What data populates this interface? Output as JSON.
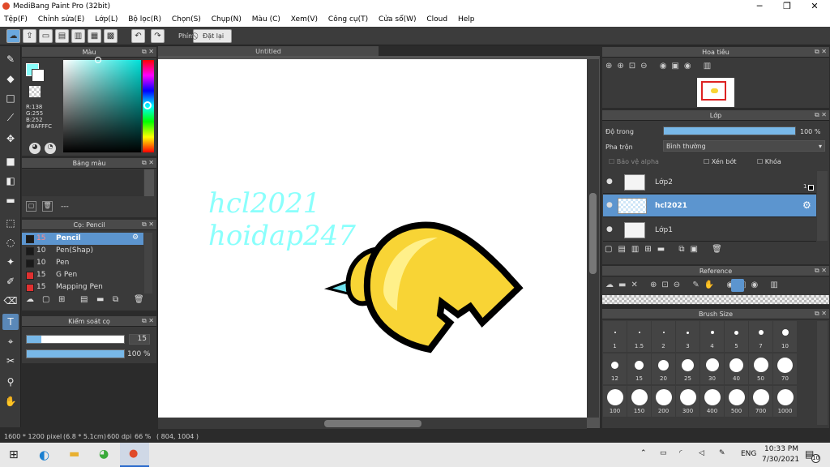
{
  "window": {
    "title": "MediBang Paint Pro (32bit)",
    "minimize": "─",
    "maximize": "❐",
    "close": "✕"
  },
  "menu": [
    "Tệp(F)",
    "Chỉnh sửa(E)",
    "Lớp(L)",
    "Bộ lọc(R)",
    "Chọn(S)",
    "Chụp(N)",
    "Màu (C)",
    "Xem(V)",
    "Công cụ(T)",
    "Cửa sổ(W)",
    "Cloud",
    "Help"
  ],
  "toolbar": {
    "phim_label": "Phím",
    "reset_label": "Đặt lại"
  },
  "color_panel": {
    "title": "Màu",
    "r": "R:138",
    "g": "G:255",
    "b": "B:252",
    "hex": "#8AFFFC",
    "fg": "#8AFFFC",
    "bg": "#ffffff"
  },
  "palette_panel": {
    "title": "Bảng màu",
    "dash": "---"
  },
  "brush_panel": {
    "title": "Cọ: Pencil",
    "items": [
      {
        "size": "15",
        "name": "Pencil",
        "color": "#1a1a1a",
        "selected": true
      },
      {
        "size": "10",
        "name": "Pen(Shap)",
        "color": "#1a1a1a",
        "selected": false
      },
      {
        "size": "10",
        "name": "Pen",
        "color": "#1a1a1a",
        "selected": false
      },
      {
        "size": "15",
        "name": "G Pen",
        "color": "#e03030",
        "selected": false
      },
      {
        "size": "15",
        "name": "Mapping Pen",
        "color": "#e03030",
        "selected": false
      }
    ]
  },
  "brush_control": {
    "title": "Kiểm soát cọ",
    "size_value": "15",
    "opacity_value": "100 %",
    "size_fraction": 0.15,
    "opacity_fraction": 1.0
  },
  "canvas": {
    "tab": "Untitled",
    "text_line1": "hcl2021",
    "text_line2": "hoidap247",
    "text_color": "#8AFFFC"
  },
  "status": {
    "size": "1600 * 1200 pixel",
    "cm": "(6.8 * 5.1cm)",
    "dpi": "600 dpi",
    "zoom": "66 %",
    "coords": "( 804, 1004 )"
  },
  "navigator": {
    "title": "Hoa tiêu"
  },
  "layer_panel": {
    "title": "Lớp",
    "opacity_label": "Độ trong",
    "opacity_value": "100 %",
    "blend_label": "Pha trộn",
    "blend_value": "Bình thường",
    "protect_alpha": "Bảo vệ alpha",
    "clipping": "Xén bớt",
    "lock": "Khóa",
    "layers": [
      {
        "name": "Lớp2",
        "selected": false,
        "badge": "1"
      },
      {
        "name": "hcl2021",
        "selected": true,
        "badge": ""
      },
      {
        "name": "Lớp1",
        "selected": false,
        "badge": ""
      }
    ]
  },
  "reference_panel": {
    "title": "Reference"
  },
  "brush_size_panel": {
    "title": "Brush Size",
    "sizes": [
      "1",
      "1.5",
      "2",
      "3",
      "4",
      "5",
      "7",
      "10",
      "12",
      "15",
      "20",
      "25",
      "30",
      "40",
      "50",
      "70",
      "100",
      "150",
      "200",
      "300",
      "400",
      "500",
      "700",
      "1000"
    ]
  },
  "taskbar": {
    "lang": "ENG",
    "time": "10:33 PM",
    "date": "7/30/2021",
    "notif_count": "10"
  }
}
